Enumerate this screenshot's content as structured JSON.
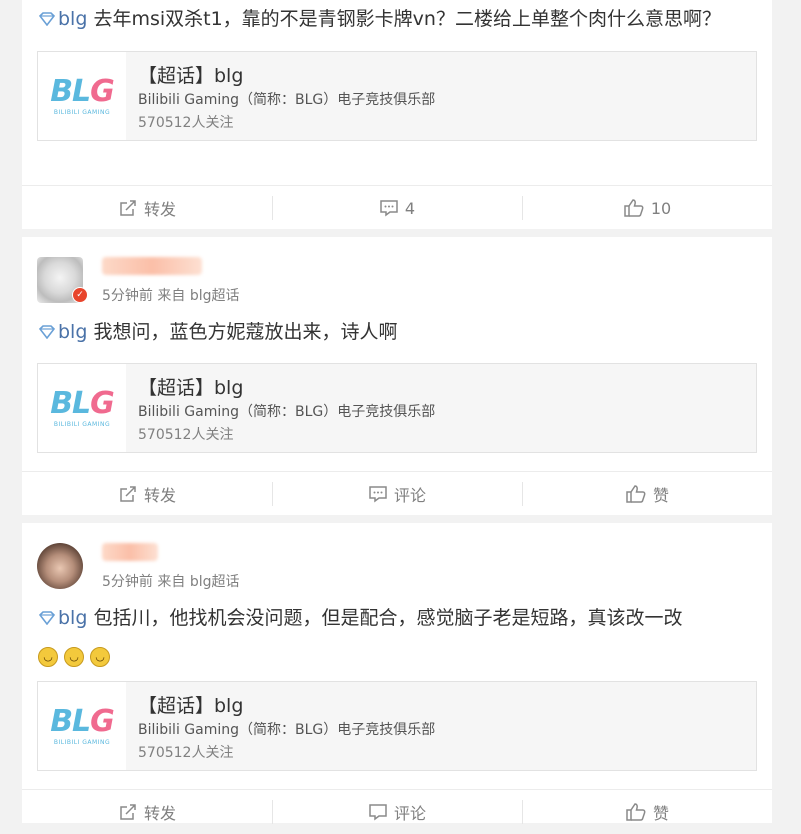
{
  "posts": [
    {
      "tag": "blg",
      "text": " 去年msi双杀t1，靠的不是青钢影卡牌vn？二楼给上单整个肉什么意思啊？",
      "topic": {
        "title": "【超话】blg",
        "desc": "Bilibili Gaming（简称：BLG）电子竞技俱乐部",
        "follow": "570512人关注",
        "logo": "BLG",
        "logo_sub": "BILIBILI GAMING"
      },
      "actions": {
        "repost": "转发",
        "comment": "4",
        "like": "10"
      }
    },
    {
      "meta_time": "5分钟前",
      "meta_from": "来自",
      "meta_source": "blg超话",
      "tag": "blg",
      "text": " 我想问，蓝色方妮蔻放出来，诗人啊",
      "topic": {
        "title": "【超话】blg",
        "desc": "Bilibili Gaming（简称：BLG）电子竞技俱乐部",
        "follow": "570512人关注",
        "logo": "BLG",
        "logo_sub": "BILIBILI GAMING"
      },
      "actions": {
        "repost": "转发",
        "comment": "评论",
        "like": "赞"
      }
    },
    {
      "meta_time": "5分钟前",
      "meta_from": "来自",
      "meta_source": "blg超话",
      "tag": "blg",
      "text": " 包括川，他找机会没问题，但是配合，感觉脑子老是短路，真该改一改",
      "topic": {
        "title": "【超话】blg",
        "desc": "Bilibili Gaming（简称：BLG）电子竞技俱乐部",
        "follow": "570512人关注",
        "logo": "BLG",
        "logo_sub": "BILIBILI GAMING"
      },
      "actions": {
        "repost": "转发",
        "comment": "评论",
        "like": "赞"
      }
    }
  ],
  "colors": {
    "tag": "#4a72a8",
    "meta": "#808080",
    "badge": "#e8452c"
  },
  "icons": {
    "tag": "diamond-icon",
    "repost": "share-icon",
    "comment": "comment-icon",
    "like": "thumbs-up-icon",
    "emoji": "laughing-crying-emoji"
  }
}
